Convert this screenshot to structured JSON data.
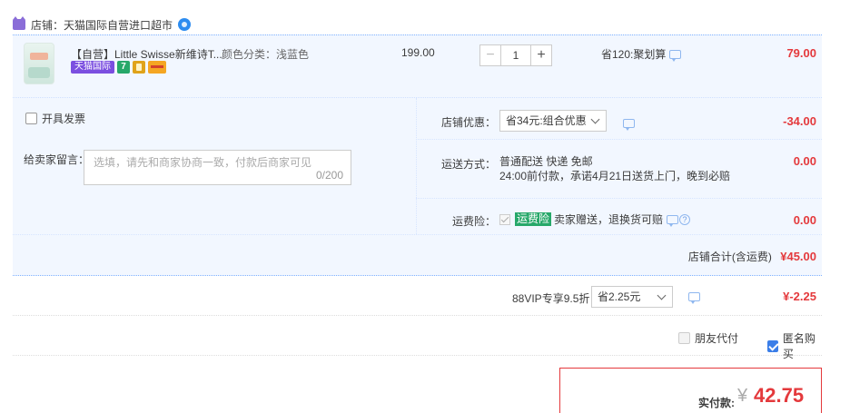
{
  "shop": {
    "label": "店铺：天猫国际自营进口超市"
  },
  "item": {
    "title": "【自营】Little Swisse新维诗T...",
    "sku": "颜色分类：浅蓝色",
    "badge_tmall": "天猫国际",
    "badge_seven": "7",
    "unit_price": "199.00",
    "quantity": "1",
    "minus": "−",
    "plus": "+",
    "discount_note": "省120:聚划算",
    "total": "79.00"
  },
  "options": {
    "invoice_label": "开具发票",
    "message_label": "给卖家留言：",
    "message_placeholder": "选填，请先和商家协商一致，付款后商家可见",
    "message_count": "0/200",
    "coupon_label": "店铺优惠：",
    "coupon_value": "省34元:组合优惠",
    "coupon_amount": "-34.00",
    "shipping_label": "运送方式：",
    "shipping_line1": "普通配送 快递 免邮",
    "shipping_line2": "24:00前付款，承诺4月21日送货上门，晚到必赔",
    "shipping_amount": "0.00",
    "insurance_label": "运费险：",
    "insurance_badge": "运费险",
    "insurance_text": "卖家赠送，退换货可赔",
    "insurance_amount": "0.00",
    "shop_total_label": "店铺合计(含运费)",
    "shop_total_amount": "¥45.00"
  },
  "vip": {
    "label": "88VIP专享9.5折",
    "select_value": "省2.25元",
    "amount": "¥-2.25"
  },
  "pay_options": {
    "friend_pay": "朋友代付",
    "anonymous": "匿名购买"
  },
  "total": {
    "label": "实付款:",
    "currency": "¥",
    "amount": "42.75"
  },
  "colors": {
    "accent_red": "#e4393c",
    "accent_blue": "#3b7ee8",
    "panel_bg": "#f2f7ff"
  }
}
